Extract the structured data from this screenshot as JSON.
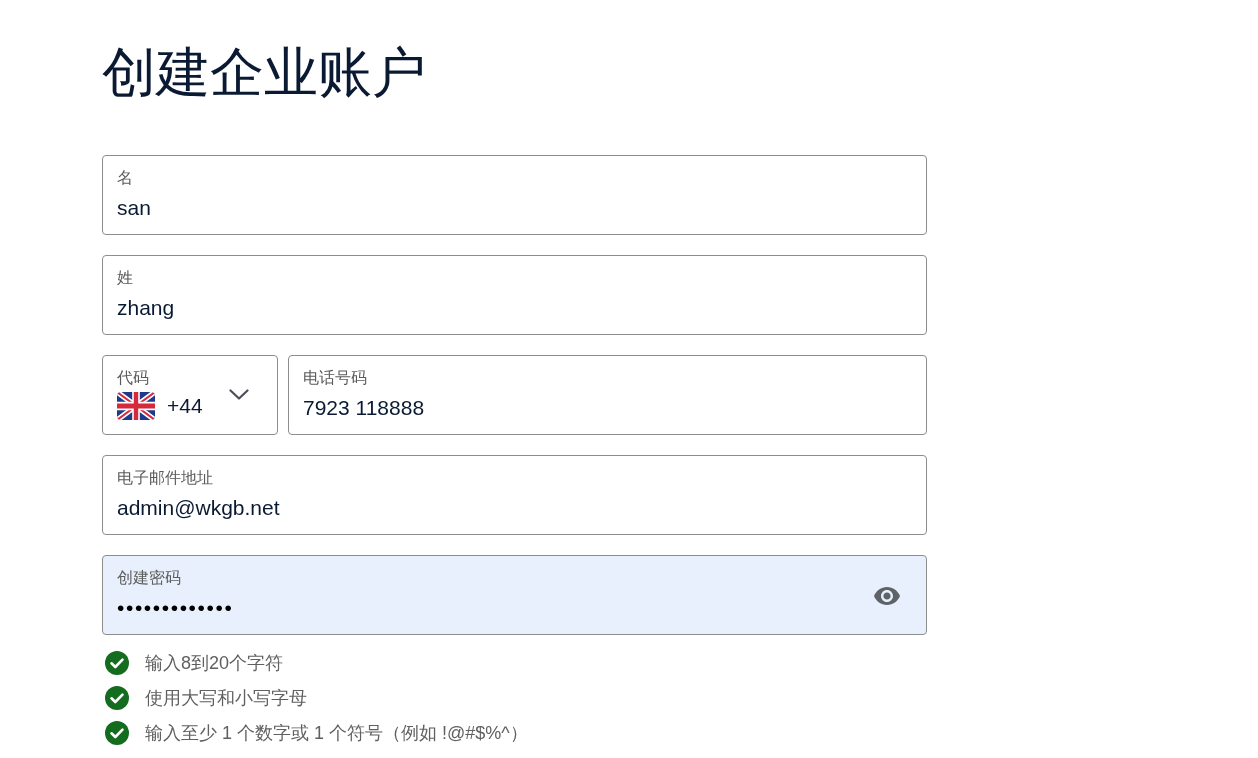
{
  "title": "创建企业账户",
  "first_name": {
    "label": "名",
    "value": "san"
  },
  "last_name": {
    "label": "姓",
    "value": "zhang"
  },
  "phone": {
    "country_code": {
      "label": "代码",
      "value": "+44"
    },
    "number": {
      "label": "电话号码",
      "value": "7923 118888"
    }
  },
  "email": {
    "label": "电子邮件地址",
    "value": "admin@wkgb.net"
  },
  "password": {
    "label": "创建密码",
    "value": "•••••••••••••",
    "autofilled": true
  },
  "requirements": [
    {
      "text": "输入8到20个字符",
      "met": true
    },
    {
      "text": "使用大写和小写字母",
      "met": true
    },
    {
      "text": "输入至少 1 个数字或 1 个符号（例如 !@#$%^）",
      "met": true
    }
  ]
}
